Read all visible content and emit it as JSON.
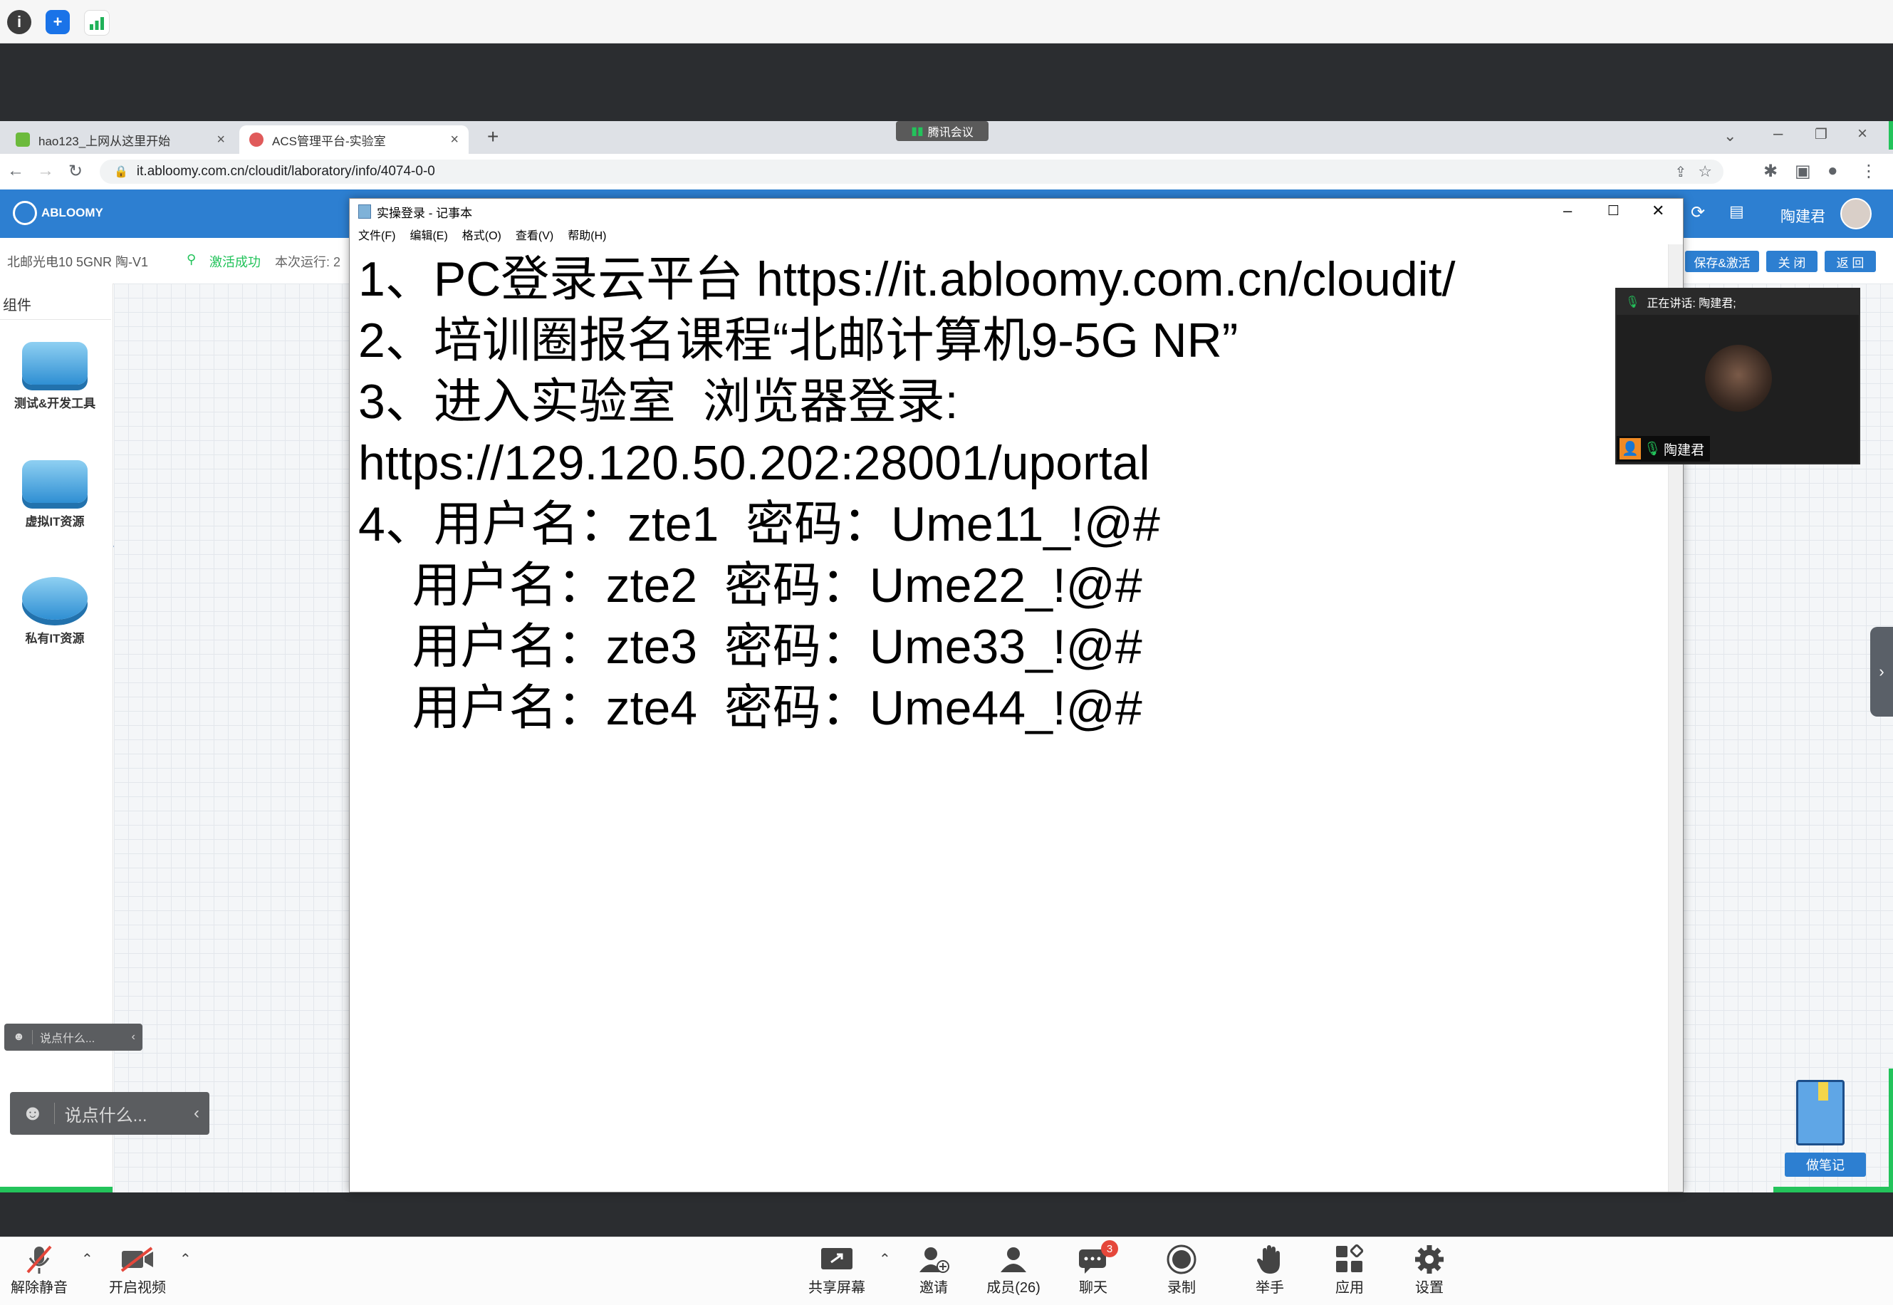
{
  "system_bar": {
    "icons": [
      "info-icon",
      "shield-icon",
      "signal-bars-icon"
    ]
  },
  "meeting_top": {
    "label": "腾讯会议"
  },
  "browser": {
    "tabs": [
      {
        "label": "hao123_上网从这里开始",
        "icon": "hao123-favicon",
        "active": false
      },
      {
        "label": "ACS管理平台-实验室",
        "icon": "abloomy-favicon",
        "active": true
      }
    ],
    "new_tab": "+",
    "url": "it.abloomy.com.cn/cloudit/laboratory/info/4074-0-0"
  },
  "app": {
    "logo": "ABLOOMY",
    "user_name": "陶建君",
    "lab_name": "北邮光电10 5GNR 陶-V1",
    "status": "激活成功",
    "runtime_label": "本次运行: 2",
    "buttons": {
      "save_activate": "保存&激活",
      "close": "关 闭",
      "back": "返 回"
    },
    "components_title": "组件",
    "tools": [
      {
        "label": "测试&开发工具",
        "icon": "test-tools-icon"
      },
      {
        "label": "虚拟IT资源",
        "icon": "virtual-it-icon"
      },
      {
        "label": "私有IT资源",
        "icon": "private-it-icon"
      }
    ],
    "collapse": "«"
  },
  "notepad": {
    "title": "实操登录 - 记事本",
    "menu": [
      "文件(F)",
      "编辑(E)",
      "格式(O)",
      "查看(V)",
      "帮助(H)"
    ],
    "lines": [
      "1、PC登录云平台 https://it.abloomy.com.cn/cloudit/",
      "2、培训圈报名课程“北邮计算机9-5G NR”",
      "3、进入实验室  浏览器登录:",
      "https://129.120.50.202:28001/uportal",
      "4、用户名：zte1  密码：Ume11_!@#",
      "    用户名：zte2  密码：Ume22_!@#",
      "    用户名：zte3  密码：Ume33_!@#",
      "    用户名：zte4  密码：Ume44_!@#"
    ]
  },
  "video": {
    "speaking_label": "正在讲话: 陶建君;",
    "participant_name": "陶建君"
  },
  "chat": {
    "placeholder_small": "说点什么...",
    "placeholder_large": "说点什么..."
  },
  "notes": {
    "label": "做笔记"
  },
  "meeting_bar": {
    "left": [
      {
        "label": "解除静音",
        "icon": "mic-muted-icon"
      },
      {
        "label": "开启视频",
        "icon": "camera-off-icon"
      }
    ],
    "center": [
      {
        "label": "共享屏幕",
        "icon": "share-screen-icon"
      },
      {
        "label": "邀请",
        "icon": "invite-icon"
      },
      {
        "label": "成员(26)",
        "icon": "members-icon"
      },
      {
        "label": "聊天",
        "icon": "chat-icon",
        "badge": "3"
      },
      {
        "label": "录制",
        "icon": "record-icon"
      },
      {
        "label": "举手",
        "icon": "raise-hand-icon"
      },
      {
        "label": "应用",
        "icon": "apps-icon"
      },
      {
        "label": "设置",
        "icon": "settings-icon"
      }
    ]
  },
  "colors": {
    "app_blue": "#2d7fd1",
    "status_green": "#23c35b",
    "badge_red": "#e5473b"
  }
}
